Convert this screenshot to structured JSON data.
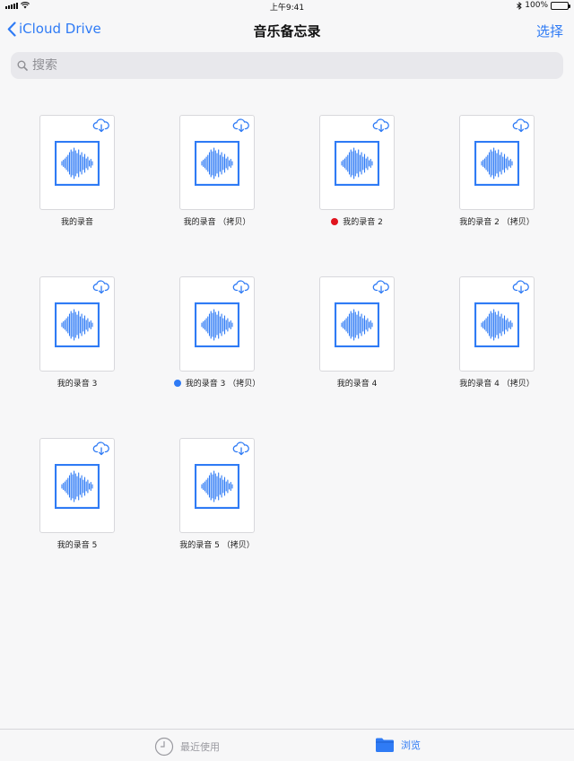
{
  "status_bar": {
    "time": "上午9:41",
    "battery": "100%",
    "battery_level": 1.0
  },
  "nav": {
    "back_label": "iCloud Drive",
    "title": "音乐备忘录",
    "action_label": "选择"
  },
  "search": {
    "placeholder": "搜索",
    "value": ""
  },
  "files": [
    {
      "name": "我的录音"
    },
    {
      "name": "我的录音 （拷贝）"
    },
    {
      "name": "我的录音 2",
      "tag_color": "#e0141e"
    },
    {
      "name": "我的录音 2 （拷贝）"
    },
    {
      "name": "我的录音 3"
    },
    {
      "name": "我的录音 3 （拷贝）",
      "tag_color": "#2f7bf5"
    },
    {
      "name": "我的录音 4"
    },
    {
      "name": "我的录音 4 （拷贝）"
    },
    {
      "name": "我的录音 5"
    },
    {
      "name": "我的录音 5 （拷贝）"
    }
  ],
  "tabs": [
    {
      "label": "最近使用",
      "icon": "clock-icon",
      "active": false
    },
    {
      "label": "浏览",
      "icon": "folder-icon",
      "active": true
    }
  ],
  "colors": {
    "accent": "#2f7bf5",
    "file_icon": "#2f7bf5"
  }
}
